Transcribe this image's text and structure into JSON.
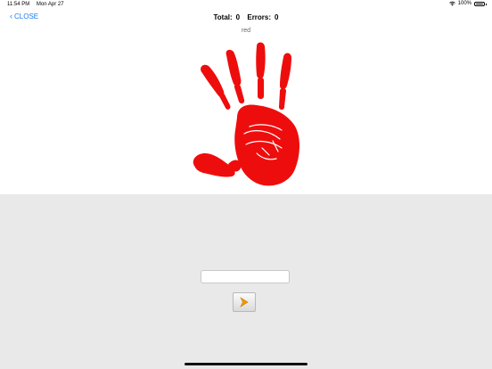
{
  "status_bar": {
    "time": "11:54 PM",
    "date": "Mon Apr 27",
    "battery": "100%",
    "wifi_icon": "wifi-icon",
    "battery_icon": "battery-icon"
  },
  "nav": {
    "back_label": "CLOSE",
    "total_label": "Total:",
    "total_value": "0",
    "errors_label": "Errors:",
    "errors_value": "0"
  },
  "card": {
    "word": "red",
    "image": "red-handprint",
    "color": "#ee0d0d"
  },
  "answer": {
    "value": "",
    "placeholder": ""
  },
  "next_button": {
    "icon": "chevron-right-icon",
    "accent": "#f29a00"
  }
}
